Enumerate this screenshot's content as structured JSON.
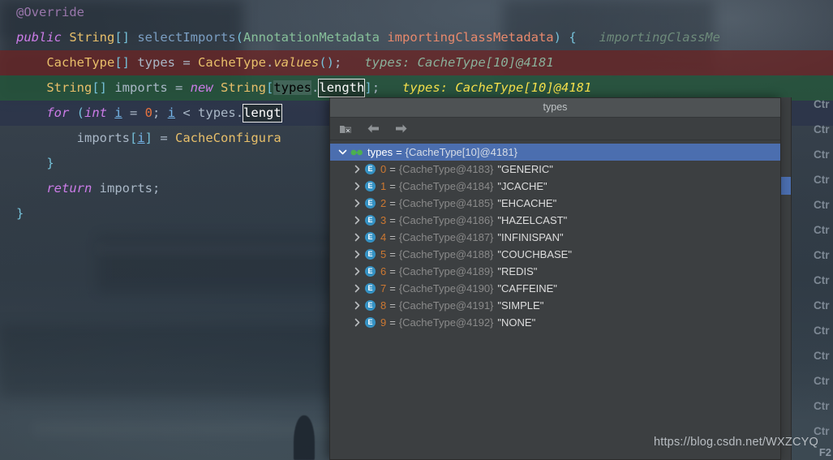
{
  "editor": {
    "lines": [
      {
        "id": "line-annotation",
        "highlight": "none",
        "indent": 0,
        "tokens": [
          {
            "cls": "field",
            "text": "@Override"
          }
        ]
      },
      {
        "id": "line-method-signature",
        "highlight": "none",
        "indent": 0,
        "tokens": [
          {
            "cls": "kw",
            "text": "public "
          },
          {
            "cls": "type",
            "text": "String"
          },
          {
            "cls": "brk",
            "text": "[]"
          },
          {
            "cls": "punc",
            "text": " "
          },
          {
            "cls": "method",
            "text": "selectImports"
          },
          {
            "cls": "brk",
            "text": "("
          },
          {
            "cls": "cls",
            "text": "AnnotationMetadata"
          },
          {
            "cls": "punc",
            "text": " "
          },
          {
            "cls": "param",
            "text": "importingClassMetadata"
          },
          {
            "cls": "brk",
            "text": ") {"
          },
          {
            "cls": "inline-hint",
            "text": "   importingClassMe"
          }
        ]
      },
      {
        "id": "line-cachetype-values",
        "highlight": "red",
        "indent": 1,
        "tokens": [
          {
            "cls": "type",
            "text": "CacheType"
          },
          {
            "cls": "brk",
            "text": "[]"
          },
          {
            "cls": "ident",
            "text": " types "
          },
          {
            "cls": "punc",
            "text": "= "
          },
          {
            "cls": "type",
            "text": "CacheType"
          },
          {
            "cls": "punc",
            "text": "."
          },
          {
            "cls": "methodi",
            "text": "values"
          },
          {
            "cls": "brk",
            "text": "()"
          },
          {
            "cls": "punc",
            "text": ";"
          },
          {
            "cls": "inline-hint-r",
            "text": "   types: CacheType[10]@4181"
          }
        ]
      },
      {
        "id": "line-string-imports",
        "highlight": "green",
        "indent": 1,
        "tokens": [
          {
            "cls": "type",
            "text": "String"
          },
          {
            "cls": "brk",
            "text": "[]"
          },
          {
            "cls": "ident",
            "text": " imports "
          },
          {
            "cls": "punc",
            "text": "= "
          },
          {
            "cls": "kw",
            "text": "new "
          },
          {
            "cls": "type",
            "text": "String"
          },
          {
            "cls": "brk",
            "text": "["
          },
          {
            "cls": "soft-sel",
            "text": "types"
          },
          {
            "cls": "punc",
            "text": "."
          },
          {
            "cls": "sel-box",
            "text": "length"
          },
          {
            "cls": "brk",
            "text": "]"
          },
          {
            "cls": "punc",
            "text": ";"
          },
          {
            "cls": "inline-hint-y",
            "text": "   types: CacheType[10]@4181"
          }
        ]
      },
      {
        "id": "line-for-loop",
        "highlight": "navy",
        "indent": 1,
        "tokens": [
          {
            "cls": "kw",
            "text": "for "
          },
          {
            "cls": "brk",
            "text": "("
          },
          {
            "cls": "kw",
            "text": "int "
          },
          {
            "cls": "lvar",
            "text": "i"
          },
          {
            "cls": "punc",
            "text": " = "
          },
          {
            "cls": "num",
            "text": "0"
          },
          {
            "cls": "punc",
            "text": "; "
          },
          {
            "cls": "lvar",
            "text": "i"
          },
          {
            "cls": "punc",
            "text": " < "
          },
          {
            "cls": "ident",
            "text": "types"
          },
          {
            "cls": "punc",
            "text": "."
          },
          {
            "cls": "sel-box",
            "text": "lengt"
          }
        ]
      },
      {
        "id": "line-imports-assign",
        "highlight": "none",
        "indent": 2,
        "tokens": [
          {
            "cls": "ident",
            "text": "imports"
          },
          {
            "cls": "brk",
            "text": "["
          },
          {
            "cls": "lvar",
            "text": "i"
          },
          {
            "cls": "brk",
            "text": "]"
          },
          {
            "cls": "punc",
            "text": " = "
          },
          {
            "cls": "type",
            "text": "CacheConfigura"
          }
        ]
      },
      {
        "id": "line-close-brace-for",
        "highlight": "none",
        "indent": 1,
        "tokens": [
          {
            "cls": "brk",
            "text": "}"
          }
        ]
      },
      {
        "id": "line-return",
        "highlight": "none",
        "indent": 1,
        "tokens": [
          {
            "cls": "kw",
            "text": "return "
          },
          {
            "cls": "ident",
            "text": "imports"
          },
          {
            "cls": "punc",
            "text": ";"
          }
        ]
      },
      {
        "id": "line-close-brace-method",
        "highlight": "none",
        "indent": 0,
        "tokens": [
          {
            "cls": "brk",
            "text": "}"
          }
        ]
      }
    ]
  },
  "popup": {
    "title": "types",
    "toolbar": [
      {
        "name": "close-frame-icon",
        "glyph": "folder-x"
      },
      {
        "name": "back-arrow-icon",
        "glyph": "arrow-left"
      },
      {
        "name": "forward-arrow-icon",
        "glyph": "arrow-right"
      }
    ],
    "root": {
      "name": "types",
      "equals": "=",
      "ref": "{CacheType[10]@4181}",
      "selected": true
    },
    "items": [
      {
        "index": "0",
        "ref": "{CacheType@4183}",
        "value": "\"GENERIC\""
      },
      {
        "index": "1",
        "ref": "{CacheType@4184}",
        "value": "\"JCACHE\""
      },
      {
        "index": "2",
        "ref": "{CacheType@4185}",
        "value": "\"EHCACHE\""
      },
      {
        "index": "3",
        "ref": "{CacheType@4186}",
        "value": "\"HAZELCAST\""
      },
      {
        "index": "4",
        "ref": "{CacheType@4187}",
        "value": "\"INFINISPAN\""
      },
      {
        "index": "5",
        "ref": "{CacheType@4188}",
        "value": "\"COUCHBASE\""
      },
      {
        "index": "6",
        "ref": "{CacheType@4189}",
        "value": "\"REDIS\""
      },
      {
        "index": "7",
        "ref": "{CacheType@4190}",
        "value": "\"CAFFEINE\""
      },
      {
        "index": "8",
        "ref": "{CacheType@4191}",
        "value": "\"SIMPLE\""
      },
      {
        "index": "9",
        "ref": "{CacheType@4192}",
        "value": "\"NONE\""
      }
    ],
    "enum_badge": "E"
  },
  "shortcuts": {
    "clipped_label": "Ctr",
    "rows": 14,
    "f2_label": "F2"
  },
  "watermark": "https://blog.csdn.net/WXZCYQ",
  "colors": {
    "selection_blue": "#4b6eaf",
    "panel_bg": "#3c3f41",
    "title_bg": "#4e5254",
    "enum_icon": "#3592c4",
    "array_icon": "#4caf50",
    "line_red": "#682626",
    "line_green": "#24563a",
    "line_navy": "#2a324a"
  }
}
